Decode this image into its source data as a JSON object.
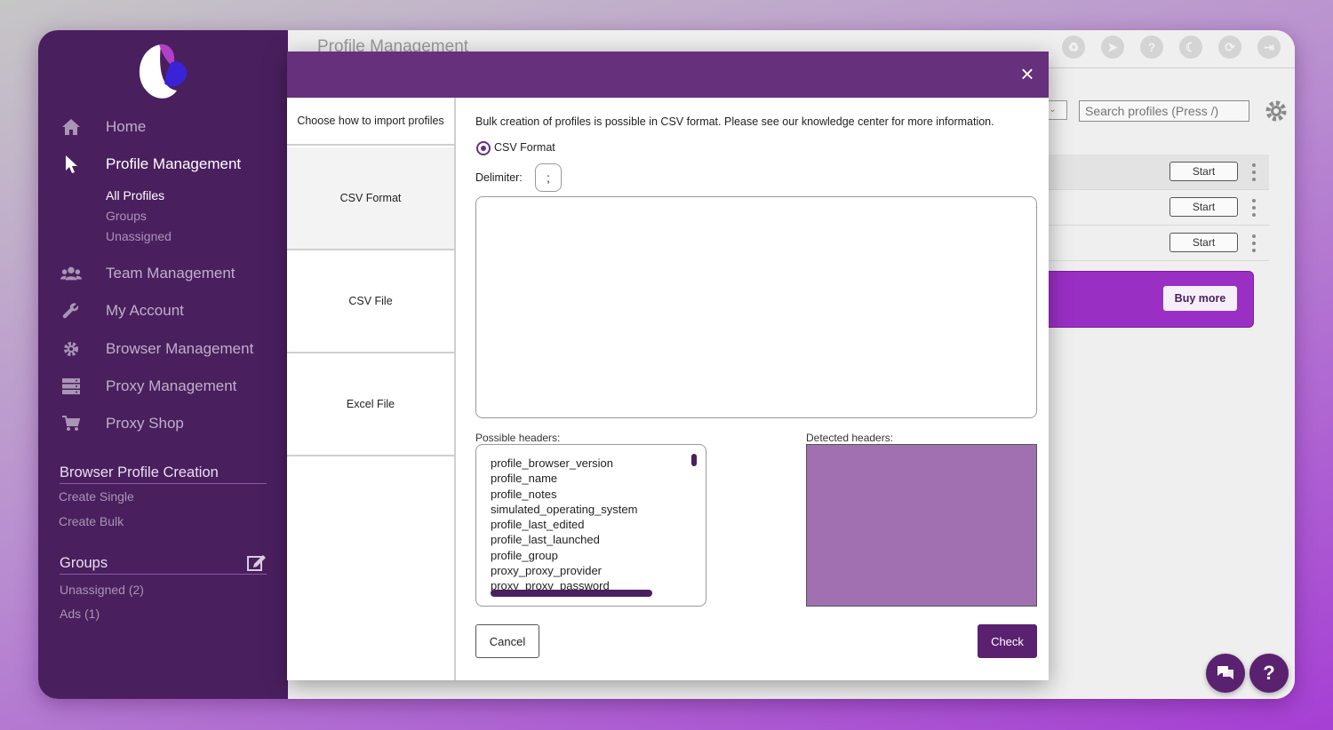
{
  "sidebar": {
    "nav": [
      {
        "label": "Home",
        "icon": "home-icon"
      },
      {
        "label": "Profile Management",
        "icon": "cursor-icon"
      },
      {
        "label": "Team Management",
        "icon": "users-icon"
      },
      {
        "label": "My Account",
        "icon": "wrench-icon"
      },
      {
        "label": "Browser Management",
        "icon": "gear-icon"
      },
      {
        "label": "Proxy Management",
        "icon": "server-icon"
      },
      {
        "label": "Proxy Shop",
        "icon": "cart-icon"
      }
    ],
    "sub_items": [
      "All Profiles",
      "Groups",
      "Unassigned"
    ],
    "creation": {
      "title": "Browser Profile Creation",
      "links": [
        "Create Single",
        "Create Bulk"
      ]
    },
    "groups": {
      "title": "Groups",
      "items": [
        "Unassigned (2)",
        "Ads (1)"
      ]
    }
  },
  "main": {
    "title": "Profile Management",
    "search_placeholder": "Search profiles (Press /)",
    "start_label": "Start",
    "buy_more_label": "Buy more",
    "help_label": "?"
  },
  "modal": {
    "left_title": "Choose how to import profiles",
    "tabs": [
      "CSV Format",
      "CSV File",
      "Excel File"
    ],
    "info": "Bulk creation of profiles is possible in CSV format. Please see our knowledge center for more information.",
    "radio_label": "CSV Format",
    "delimiter_label": "Delimiter:",
    "delimiter_value": ";",
    "possible_headers_label": "Possible headers:",
    "detected_headers_label": "Detected headers:",
    "possible_headers": [
      "profile_browser_version",
      "profile_name",
      "profile_notes",
      "simulated_operating_system",
      "profile_last_edited",
      "profile_last_launched",
      "profile_group",
      "proxy_proxy_provider",
      "proxy_proxy_password"
    ],
    "cancel_label": "Cancel",
    "check_label": "Check"
  },
  "colors": {
    "sidebar_bg": "#4a1f5e",
    "modal_header": "#66307c",
    "accent": "#5a2170",
    "detected_box": "#a070b1",
    "promo": "#9a2fc4"
  }
}
